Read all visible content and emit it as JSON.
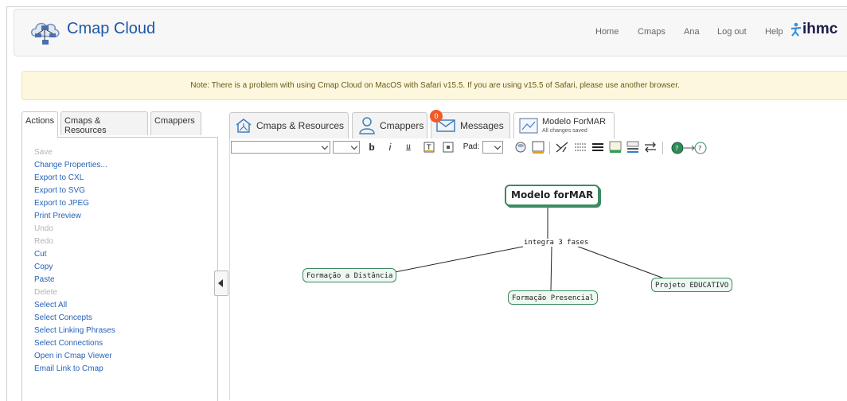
{
  "app": {
    "title": "Cmap Cloud"
  },
  "topnav": [
    "Home",
    "Cmaps",
    "Ana",
    "Log out",
    "Help"
  ],
  "brand": {
    "partner_logo": "ihmc"
  },
  "notice": "Note: There is a problem with using Cmap Cloud on MacOS with Safari v15.5. If you are using v15.5 of Safari, please use another browser.",
  "left_tabs": [
    "Actions",
    "Cmaps & Resources",
    "Cmappers"
  ],
  "actions_menu": [
    {
      "label": "Save",
      "enabled": false
    },
    {
      "label": "Change Properties...",
      "enabled": true
    },
    {
      "label": "Export to CXL",
      "enabled": true
    },
    {
      "label": "Export to SVG",
      "enabled": true
    },
    {
      "label": "Export to JPEG",
      "enabled": true
    },
    {
      "label": "Print Preview",
      "enabled": true
    },
    {
      "label": "Undo",
      "enabled": false
    },
    {
      "label": "Redo",
      "enabled": false
    },
    {
      "label": "Cut",
      "enabled": true
    },
    {
      "label": "Copy",
      "enabled": true
    },
    {
      "label": "Paste",
      "enabled": true
    },
    {
      "label": "Delete",
      "enabled": false
    },
    {
      "label": "Select All",
      "enabled": true
    },
    {
      "label": "Select Concepts",
      "enabled": true
    },
    {
      "label": "Select Linking Phrases",
      "enabled": true
    },
    {
      "label": "Select Connections",
      "enabled": true
    },
    {
      "label": "Open in Cmap Viewer",
      "enabled": true
    },
    {
      "label": "Email Link to Cmap",
      "enabled": true
    }
  ],
  "right_tabs": {
    "resources": "Cmaps & Resources",
    "cmappers": "Cmappers",
    "messages": "Messages",
    "messages_count": "0",
    "doc_title": "Modelo ForMAR",
    "doc_status": "All changes saved"
  },
  "toolbar": {
    "bold": "b",
    "italic": "i",
    "underline": "u",
    "pad_label": "Pad:"
  },
  "concept_map": {
    "root": "Modelo forMAR",
    "linking_phrase": "integra 3 fases",
    "concepts": [
      "Formação a Distância",
      "Formação Presencial",
      "Projeto EDUCATIVO"
    ]
  },
  "colors": {
    "link": "#2563b8",
    "concept_border": "#3e8a62",
    "notice_bg": "#fcf7dd",
    "badge": "#f05a28"
  }
}
